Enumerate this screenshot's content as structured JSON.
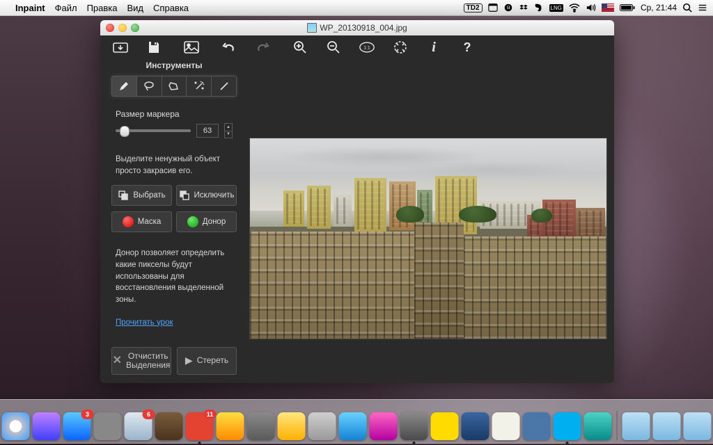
{
  "menubar": {
    "app": "Inpaint",
    "items": [
      "Файл",
      "Правка",
      "Вид",
      "Справка"
    ],
    "td2": "2",
    "clock": "Ср, 21:44"
  },
  "window": {
    "title": "WP_20130918_004.jpg"
  },
  "toolbar": {
    "open": "open",
    "save": "save",
    "image": "image",
    "undo": "undo",
    "redo": "redo",
    "zoom_in": "zoom-in",
    "zoom_out": "zoom-out",
    "zoom_actual": "1:1",
    "zoom_fit": "fit",
    "info": "i",
    "help": "?"
  },
  "sidebar": {
    "tools_title": "Инструменты",
    "marker_label": "Размер маркера",
    "marker_value": "63",
    "hint1": "Выделите ненужный объект просто закрасив его.",
    "select_btn": "Выбрать",
    "exclude_btn": "Исключить",
    "mask_btn": "Маска",
    "donor_btn": "Донор",
    "hint2": "Донор позволяет определить какие пикселы будут использованы для восстановления выделенной зоны.",
    "tutorial_link": "Прочитать урок",
    "clear_btn_l1": "Отчистить",
    "clear_btn_l2": "Выделения",
    "erase_btn": "Стереть"
  },
  "dock": {
    "badges": {
      "mail": "6",
      "appstore": "3",
      "todoist": "11"
    }
  }
}
